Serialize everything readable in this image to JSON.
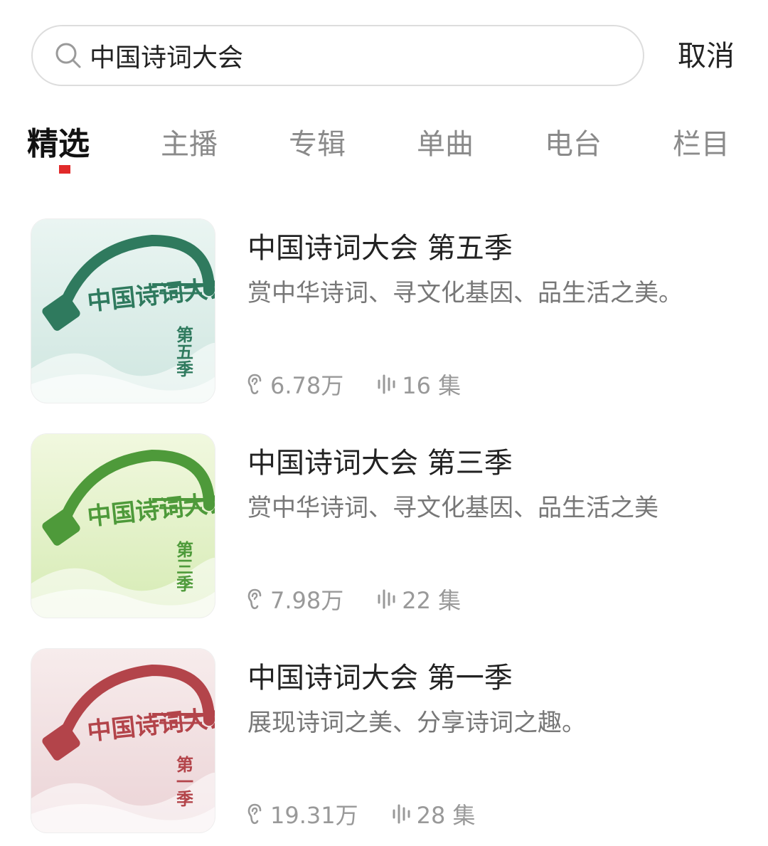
{
  "search": {
    "value": "中国诗词大会",
    "placeholder": "",
    "cancel_label": "取消"
  },
  "tabs": [
    {
      "label": "精选",
      "active": true
    },
    {
      "label": "主播",
      "active": false
    },
    {
      "label": "专辑",
      "active": false
    },
    {
      "label": "单曲",
      "active": false
    },
    {
      "label": "电台",
      "active": false
    },
    {
      "label": "栏目",
      "active": false
    }
  ],
  "accent_color": "#e12a2a",
  "results": [
    {
      "title": "中国诗词大会 第五季",
      "description": "赏中华诗词、寻文化基因、品生活之美。",
      "plays": "6.78万",
      "episodes": "16 集",
      "cover": {
        "season_label": "第五季",
        "logo_text": "中国诗词大会",
        "theme_color": "#2f7a5e",
        "bg_top": "#eaf5f2",
        "bg_bottom": "#cfe6e0"
      }
    },
    {
      "title": "中国诗词大会 第三季",
      "description": "赏中华诗词、寻文化基因、品生活之美",
      "plays": "7.98万",
      "episodes": "22 集",
      "cover": {
        "season_label": "第三季",
        "logo_text": "中国诗词大会",
        "theme_color": "#4e9a3a",
        "bg_top": "#f1f8df",
        "bg_bottom": "#d6ebb4"
      }
    },
    {
      "title": "中国诗词大会 第一季",
      "description": "展现诗词之美、分享诗词之趣。",
      "plays": "19.31万",
      "episodes": "28 集",
      "cover": {
        "season_label": "第一季",
        "logo_text": "中国诗词大会",
        "theme_color": "#b3444a",
        "bg_top": "#f7ecec",
        "bg_bottom": "#ebd3d6"
      }
    }
  ]
}
